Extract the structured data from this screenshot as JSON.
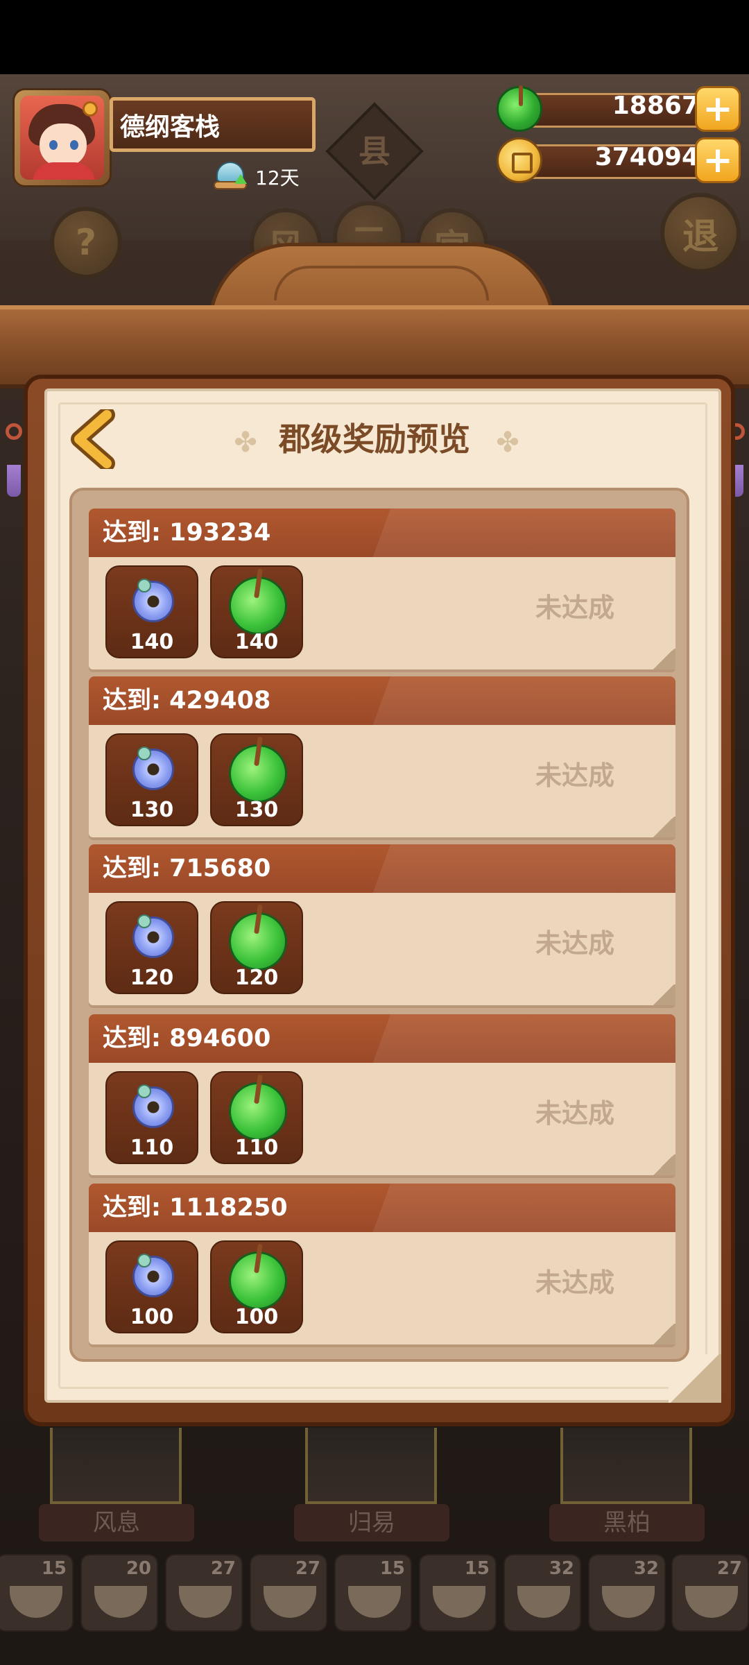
{
  "player": {
    "name": "德纲客栈",
    "days": "12天"
  },
  "currency": {
    "jade": "18867",
    "coins": "374094",
    "plus": "+"
  },
  "background": {
    "help": "?",
    "county": "县",
    "exit": "退",
    "tabs": [
      "风",
      "二",
      "宫"
    ]
  },
  "panel": {
    "title": "郡级奖励预览",
    "tiers": [
      {
        "header": "达到: 193234",
        "ring": "140",
        "jade": "140",
        "status": "未达成"
      },
      {
        "header": "达到: 429408",
        "ring": "130",
        "jade": "130",
        "status": "未达成"
      },
      {
        "header": "达到: 715680",
        "ring": "120",
        "jade": "120",
        "status": "未达成"
      },
      {
        "header": "达到: 894600",
        "ring": "110",
        "jade": "110",
        "status": "未达成"
      },
      {
        "header": "达到: 1118250",
        "ring": "100",
        "jade": "100",
        "status": "未达成"
      }
    ]
  },
  "characters": [
    "风息",
    "归易",
    "黑柏"
  ],
  "dishes": [
    "15",
    "20",
    "27",
    "27",
    "15",
    "15",
    "32",
    "32",
    "27"
  ],
  "colors": {
    "accent": "#9b4928",
    "panel": "#f6e8d3",
    "title": "#7b4a26",
    "status_unreached": "#c2a88f"
  }
}
